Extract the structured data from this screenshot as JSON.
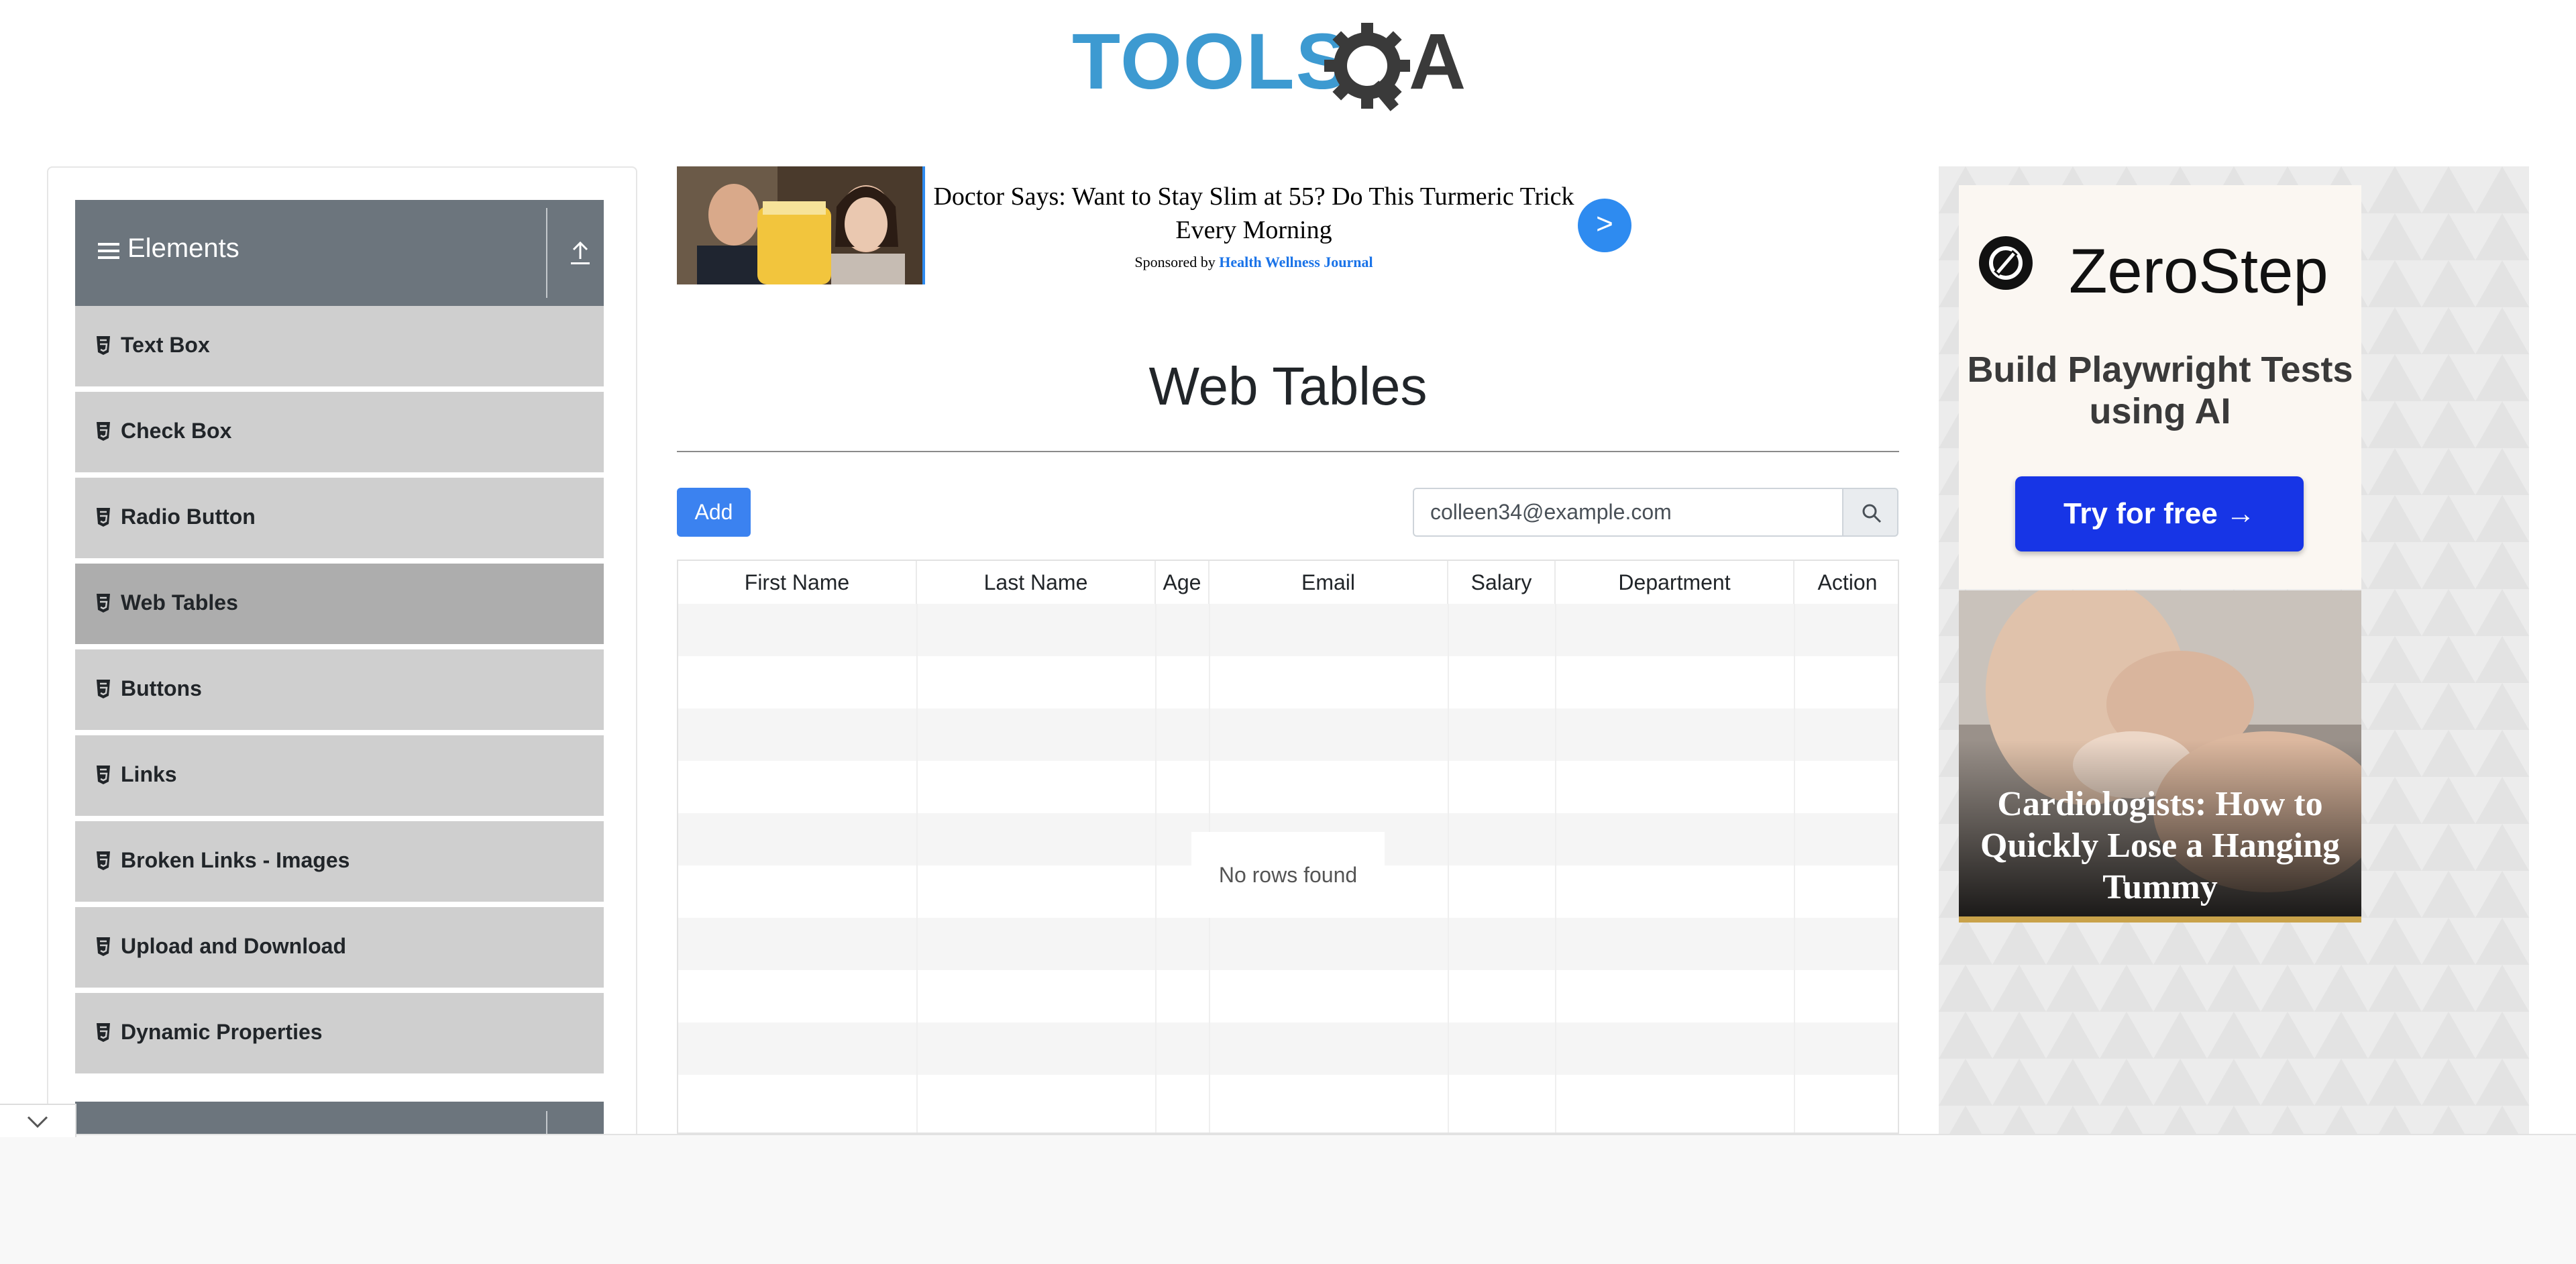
{
  "header": {
    "logo_text_left": "TOOLS",
    "logo_text_right": "A"
  },
  "sidebar": {
    "group_title": "Elements",
    "items": [
      {
        "label": "Text Box",
        "active": false
      },
      {
        "label": "Check Box",
        "active": false
      },
      {
        "label": "Radio Button",
        "active": false
      },
      {
        "label": "Web Tables",
        "active": true
      },
      {
        "label": "Buttons",
        "active": false
      },
      {
        "label": "Links",
        "active": false
      },
      {
        "label": "Broken Links - Images",
        "active": false
      },
      {
        "label": "Upload and Download",
        "active": false
      },
      {
        "label": "Dynamic Properties",
        "active": false
      }
    ]
  },
  "ad_banner": {
    "headline": "Doctor Says: Want to Stay Slim at 55? Do This Turmeric Trick Every Morning",
    "sponsor_prefix": "Sponsored by",
    "sponsor_name": "Health Wellness Journal",
    "arrow": ">"
  },
  "main": {
    "title": "Web Tables",
    "add_label": "Add",
    "search_value": "colleen34@example.com",
    "table": {
      "headers": [
        "First Name",
        "Last Name",
        "Age",
        "Email",
        "Salary",
        "Department",
        "Action"
      ],
      "empty_message": "No rows found"
    }
  },
  "right_ad": {
    "brand": "ZeroStep",
    "tagline": "Build Playwright Tests using AI",
    "cta": "Try for free →",
    "caption": "Cardiologists: How to Quickly Lose a Hanging Tummy"
  },
  "colors": {
    "accent": "#3b82f0",
    "sidebar_header": "#6c757d",
    "sidebar_item": "#cfcfcf",
    "sidebar_active": "#adadad",
    "cta_blue": "#1735e6"
  }
}
